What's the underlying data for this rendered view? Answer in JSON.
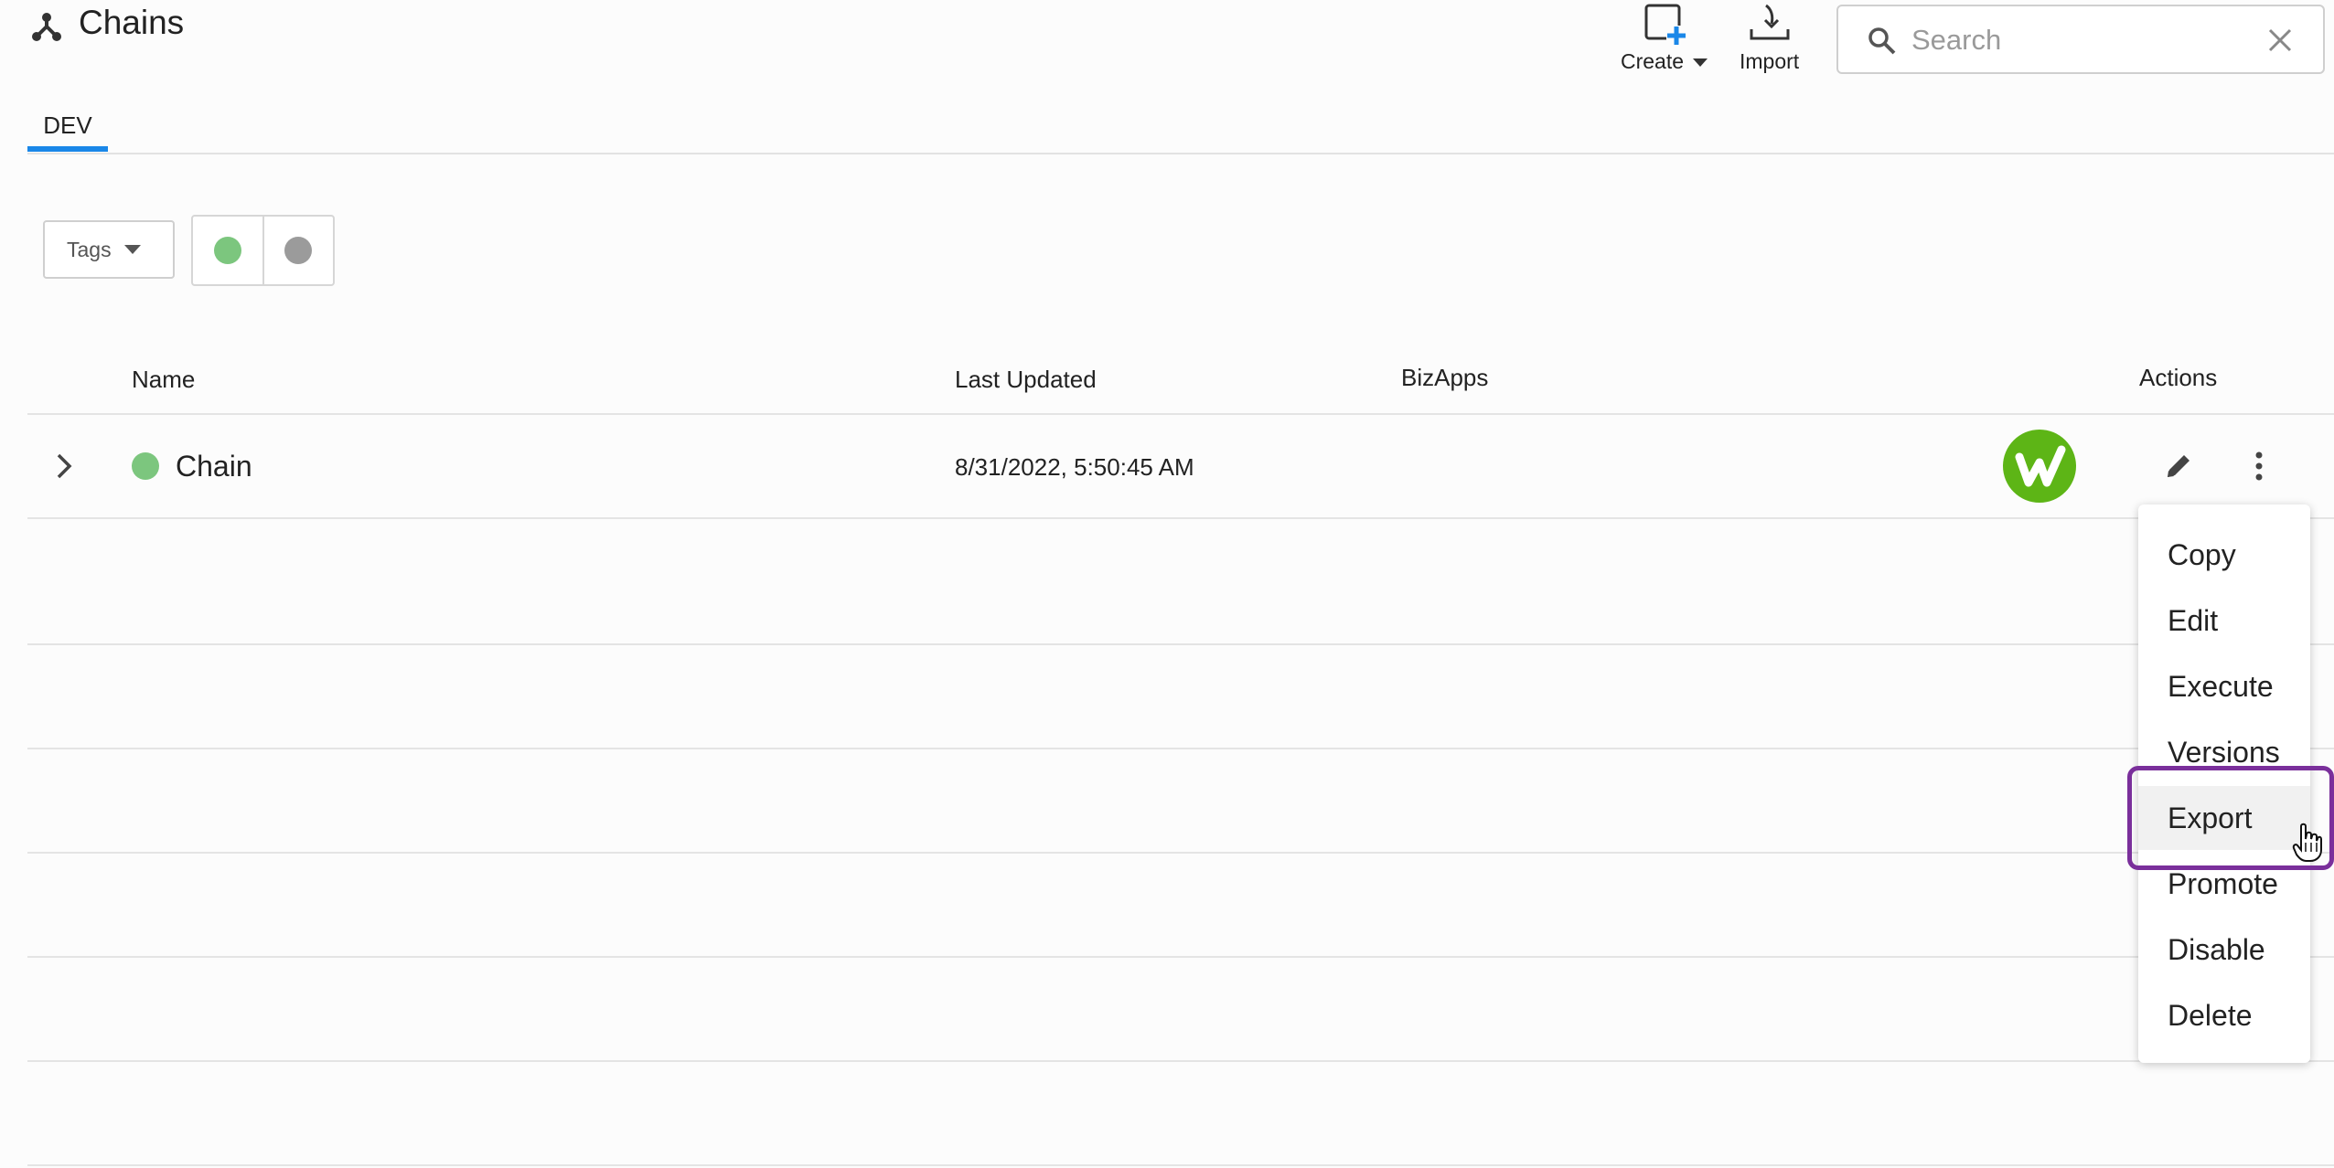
{
  "header": {
    "title": "Chains",
    "create_label": "Create",
    "import_label": "Import"
  },
  "search": {
    "placeholder": "Search",
    "value": ""
  },
  "tabs": [
    {
      "label": "DEV",
      "active": true
    }
  ],
  "filters": {
    "tags_label": "Tags",
    "status_colors": [
      "#7cc67e",
      "#9b9b9b"
    ]
  },
  "table": {
    "columns": [
      "Name",
      "Last Updated",
      "BizApps",
      "Actions"
    ],
    "rows": [
      {
        "name": "Chain",
        "last_updated": "8/31/2022, 5:50:45 AM",
        "status_color": "#7cc67e",
        "bizapp_icon": "w-check-logo"
      }
    ]
  },
  "actions_menu": {
    "items": [
      "Copy",
      "Edit",
      "Execute",
      "Versions",
      "Export",
      "Promote",
      "Disable",
      "Delete"
    ],
    "highlighted": "Export"
  },
  "colors": {
    "accent": "#1a87e8",
    "highlight_border": "#7a2f9b",
    "bizapp_green": "#5db516"
  }
}
